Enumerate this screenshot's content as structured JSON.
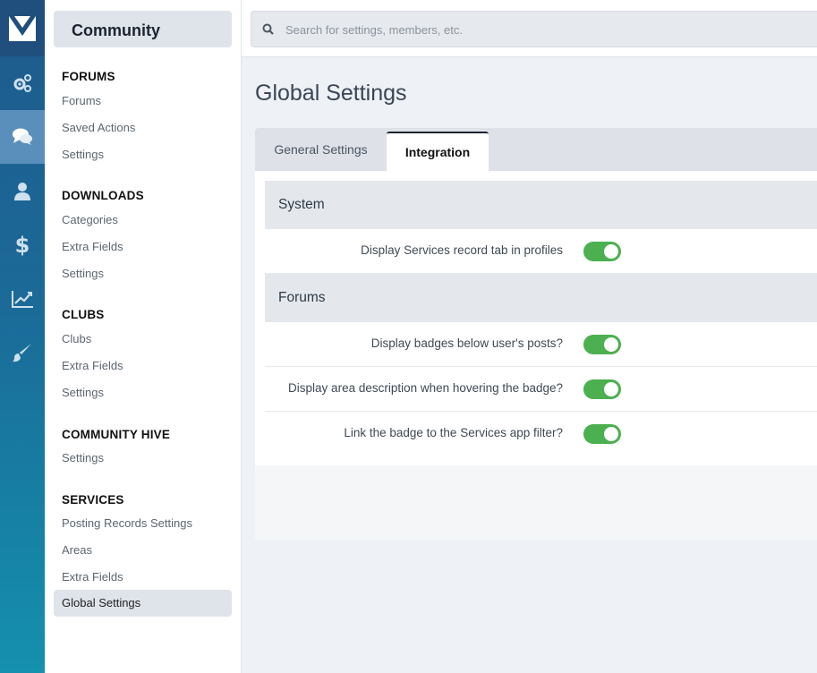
{
  "rail": {
    "items": [
      {
        "icon": "gears-icon"
      },
      {
        "icon": "chat-icon",
        "active": true
      },
      {
        "icon": "user-icon"
      },
      {
        "icon": "dollar-icon"
      },
      {
        "icon": "chart-line-icon"
      },
      {
        "icon": "brush-icon"
      }
    ]
  },
  "menu": {
    "title": "Community",
    "sections": [
      {
        "title": "FORUMS",
        "links": [
          "Forums",
          "Saved Actions",
          "Settings"
        ]
      },
      {
        "title": "DOWNLOADS",
        "links": [
          "Categories",
          "Extra Fields",
          "Settings"
        ]
      },
      {
        "title": "CLUBS",
        "links": [
          "Clubs",
          "Extra Fields",
          "Settings"
        ]
      },
      {
        "title": "COMMUNITY HIVE",
        "links": [
          "Settings"
        ]
      },
      {
        "title": "SERVICES",
        "links": [
          "Posting Records Settings",
          "Areas",
          "Extra Fields",
          "Global Settings"
        ]
      }
    ],
    "active_link": "Global Settings"
  },
  "search": {
    "placeholder": "Search for settings, members, etc."
  },
  "page": {
    "title": "Global Settings",
    "tabs": [
      {
        "label": "General Settings",
        "active": false
      },
      {
        "label": "Integration",
        "active": true
      }
    ],
    "groups": [
      {
        "title": "System",
        "settings": [
          {
            "label": "Display Services record tab in profiles",
            "enabled": true
          }
        ]
      },
      {
        "title": "Forums",
        "settings": [
          {
            "label": "Display badges below user's posts?",
            "enabled": true
          },
          {
            "label": "Display area description when hovering the badge?",
            "enabled": true
          },
          {
            "label": "Link the badge to the Services app filter?",
            "enabled": true
          }
        ]
      }
    ]
  },
  "colors": {
    "toggle_on": "#4caf50",
    "rail_top": "#1e5a8c",
    "rail_bottom": "#1590ae"
  }
}
